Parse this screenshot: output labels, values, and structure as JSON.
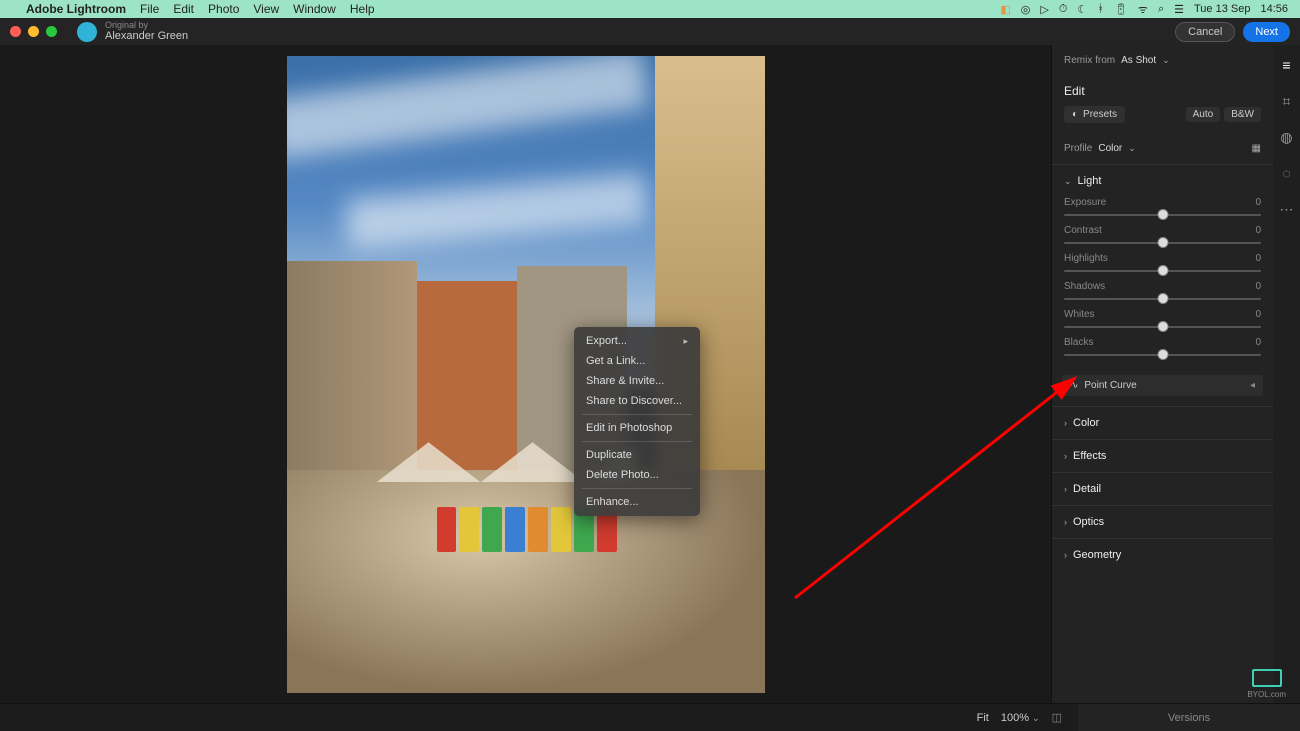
{
  "mac": {
    "app_name": "Adobe Lightroom",
    "menus": [
      "File",
      "Edit",
      "Photo",
      "View",
      "Window",
      "Help"
    ],
    "date": "Tue 13 Sep",
    "time": "14:56"
  },
  "titlebar": {
    "original_by": "Original by",
    "author": "Alexander Green",
    "cancel": "Cancel",
    "next": "Next"
  },
  "context_menu": {
    "items": [
      {
        "label": "Export...",
        "has_submenu": true
      },
      {
        "label": "Get a Link...",
        "has_submenu": false
      },
      {
        "label": "Share & Invite...",
        "has_submenu": false
      },
      {
        "label": "Share to Discover...",
        "has_submenu": false
      },
      {
        "label": "Edit in Photoshop",
        "has_submenu": false,
        "sep_before": true
      },
      {
        "label": "Duplicate",
        "has_submenu": false,
        "sep_before": true
      },
      {
        "label": "Delete Photo...",
        "has_submenu": false
      },
      {
        "label": "Enhance...",
        "has_submenu": false,
        "sep_before": true
      }
    ]
  },
  "panel": {
    "remix_label": "Remix from",
    "remix_value": "As Shot",
    "edit": "Edit",
    "presets": "Presets",
    "auto": "Auto",
    "bw": "B&W",
    "profile_label": "Profile",
    "profile_value": "Color",
    "light": "Light",
    "sliders": [
      {
        "label": "Exposure",
        "value": "0"
      },
      {
        "label": "Contrast",
        "value": "0"
      },
      {
        "label": "Highlights",
        "value": "0"
      },
      {
        "label": "Shadows",
        "value": "0"
      },
      {
        "label": "Whites",
        "value": "0"
      },
      {
        "label": "Blacks",
        "value": "0"
      }
    ],
    "point_curve": "Point Curve",
    "sections": [
      "Color",
      "Effects",
      "Detail",
      "Optics",
      "Geometry"
    ],
    "versions": "Versions"
  },
  "bottom": {
    "fit": "Fit",
    "zoom": "100%"
  },
  "watermark": "BYOL.com"
}
